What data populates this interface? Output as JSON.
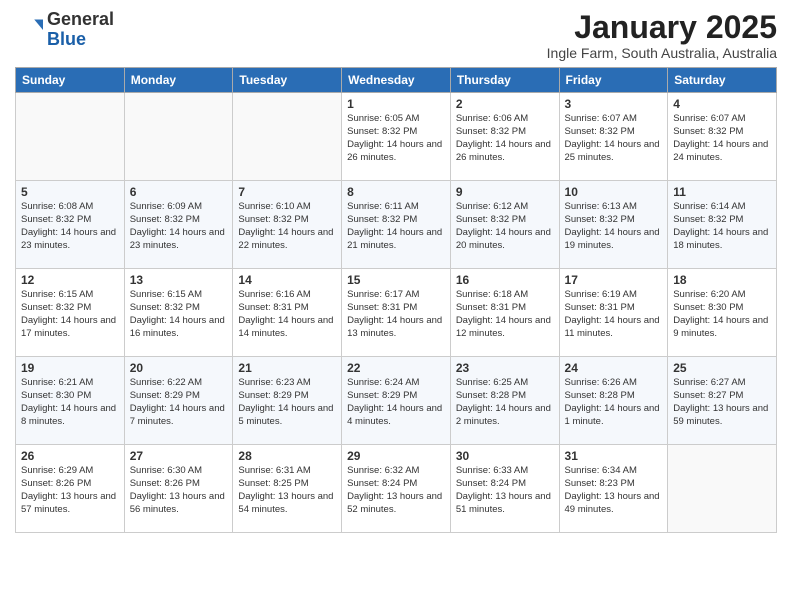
{
  "header": {
    "logo_general": "General",
    "logo_blue": "Blue",
    "month": "January 2025",
    "location": "Ingle Farm, South Australia, Australia"
  },
  "days_of_week": [
    "Sunday",
    "Monday",
    "Tuesday",
    "Wednesday",
    "Thursday",
    "Friday",
    "Saturday"
  ],
  "weeks": [
    [
      {
        "day": "",
        "info": ""
      },
      {
        "day": "",
        "info": ""
      },
      {
        "day": "",
        "info": ""
      },
      {
        "day": "1",
        "info": "Sunrise: 6:05 AM\nSunset: 8:32 PM\nDaylight: 14 hours\nand 26 minutes."
      },
      {
        "day": "2",
        "info": "Sunrise: 6:06 AM\nSunset: 8:32 PM\nDaylight: 14 hours\nand 26 minutes."
      },
      {
        "day": "3",
        "info": "Sunrise: 6:07 AM\nSunset: 8:32 PM\nDaylight: 14 hours\nand 25 minutes."
      },
      {
        "day": "4",
        "info": "Sunrise: 6:07 AM\nSunset: 8:32 PM\nDaylight: 14 hours\nand 24 minutes."
      }
    ],
    [
      {
        "day": "5",
        "info": "Sunrise: 6:08 AM\nSunset: 8:32 PM\nDaylight: 14 hours\nand 23 minutes."
      },
      {
        "day": "6",
        "info": "Sunrise: 6:09 AM\nSunset: 8:32 PM\nDaylight: 14 hours\nand 23 minutes."
      },
      {
        "day": "7",
        "info": "Sunrise: 6:10 AM\nSunset: 8:32 PM\nDaylight: 14 hours\nand 22 minutes."
      },
      {
        "day": "8",
        "info": "Sunrise: 6:11 AM\nSunset: 8:32 PM\nDaylight: 14 hours\nand 21 minutes."
      },
      {
        "day": "9",
        "info": "Sunrise: 6:12 AM\nSunset: 8:32 PM\nDaylight: 14 hours\nand 20 minutes."
      },
      {
        "day": "10",
        "info": "Sunrise: 6:13 AM\nSunset: 8:32 PM\nDaylight: 14 hours\nand 19 minutes."
      },
      {
        "day": "11",
        "info": "Sunrise: 6:14 AM\nSunset: 8:32 PM\nDaylight: 14 hours\nand 18 minutes."
      }
    ],
    [
      {
        "day": "12",
        "info": "Sunrise: 6:15 AM\nSunset: 8:32 PM\nDaylight: 14 hours\nand 17 minutes."
      },
      {
        "day": "13",
        "info": "Sunrise: 6:15 AM\nSunset: 8:32 PM\nDaylight: 14 hours\nand 16 minutes."
      },
      {
        "day": "14",
        "info": "Sunrise: 6:16 AM\nSunset: 8:31 PM\nDaylight: 14 hours\nand 14 minutes."
      },
      {
        "day": "15",
        "info": "Sunrise: 6:17 AM\nSunset: 8:31 PM\nDaylight: 14 hours\nand 13 minutes."
      },
      {
        "day": "16",
        "info": "Sunrise: 6:18 AM\nSunset: 8:31 PM\nDaylight: 14 hours\nand 12 minutes."
      },
      {
        "day": "17",
        "info": "Sunrise: 6:19 AM\nSunset: 8:31 PM\nDaylight: 14 hours\nand 11 minutes."
      },
      {
        "day": "18",
        "info": "Sunrise: 6:20 AM\nSunset: 8:30 PM\nDaylight: 14 hours\nand 9 minutes."
      }
    ],
    [
      {
        "day": "19",
        "info": "Sunrise: 6:21 AM\nSunset: 8:30 PM\nDaylight: 14 hours\nand 8 minutes."
      },
      {
        "day": "20",
        "info": "Sunrise: 6:22 AM\nSunset: 8:29 PM\nDaylight: 14 hours\nand 7 minutes."
      },
      {
        "day": "21",
        "info": "Sunrise: 6:23 AM\nSunset: 8:29 PM\nDaylight: 14 hours\nand 5 minutes."
      },
      {
        "day": "22",
        "info": "Sunrise: 6:24 AM\nSunset: 8:29 PM\nDaylight: 14 hours\nand 4 minutes."
      },
      {
        "day": "23",
        "info": "Sunrise: 6:25 AM\nSunset: 8:28 PM\nDaylight: 14 hours\nand 2 minutes."
      },
      {
        "day": "24",
        "info": "Sunrise: 6:26 AM\nSunset: 8:28 PM\nDaylight: 14 hours\nand 1 minute."
      },
      {
        "day": "25",
        "info": "Sunrise: 6:27 AM\nSunset: 8:27 PM\nDaylight: 13 hours\nand 59 minutes."
      }
    ],
    [
      {
        "day": "26",
        "info": "Sunrise: 6:29 AM\nSunset: 8:26 PM\nDaylight: 13 hours\nand 57 minutes."
      },
      {
        "day": "27",
        "info": "Sunrise: 6:30 AM\nSunset: 8:26 PM\nDaylight: 13 hours\nand 56 minutes."
      },
      {
        "day": "28",
        "info": "Sunrise: 6:31 AM\nSunset: 8:25 PM\nDaylight: 13 hours\nand 54 minutes."
      },
      {
        "day": "29",
        "info": "Sunrise: 6:32 AM\nSunset: 8:24 PM\nDaylight: 13 hours\nand 52 minutes."
      },
      {
        "day": "30",
        "info": "Sunrise: 6:33 AM\nSunset: 8:24 PM\nDaylight: 13 hours\nand 51 minutes."
      },
      {
        "day": "31",
        "info": "Sunrise: 6:34 AM\nSunset: 8:23 PM\nDaylight: 13 hours\nand 49 minutes."
      },
      {
        "day": "",
        "info": ""
      }
    ]
  ]
}
